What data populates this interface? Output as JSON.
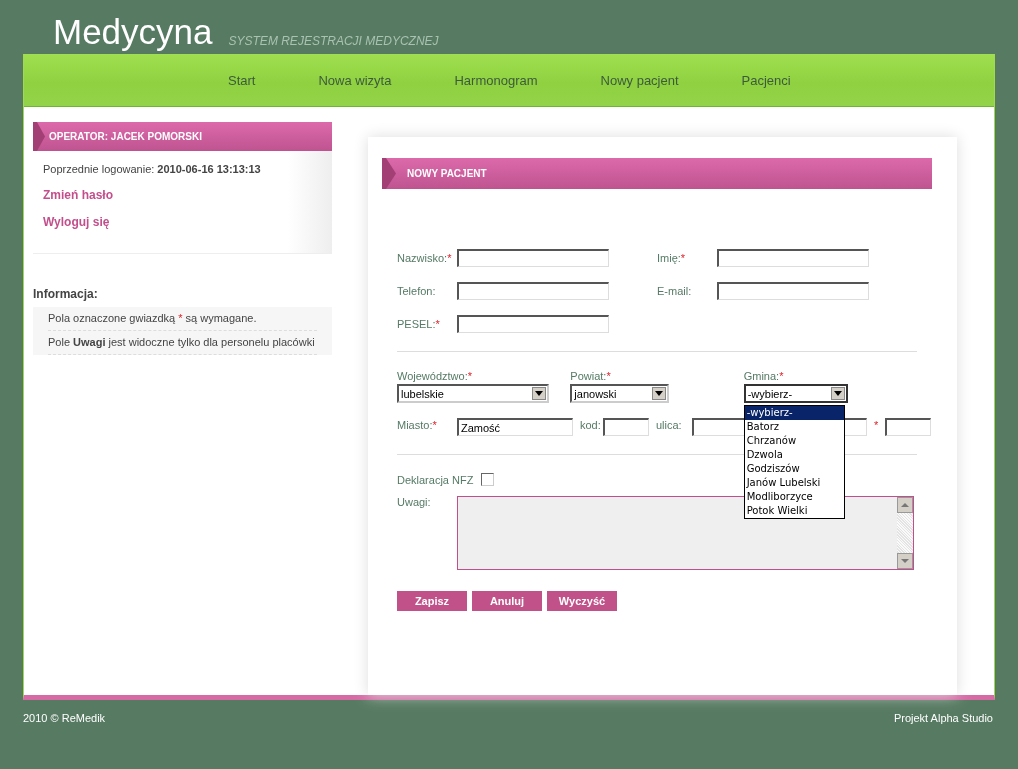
{
  "header": {
    "title": "Medycyna",
    "subtitle": "SYSTEM REJESTRACJI MEDYCZNEJ"
  },
  "nav": [
    {
      "label": "Start"
    },
    {
      "label": "Nowa wizyta"
    },
    {
      "label": "Harmonogram"
    },
    {
      "label": "Nowy pacjent"
    },
    {
      "label": "Pacjenci"
    }
  ],
  "operator_panel": {
    "title": "OPERATOR: JACEK POMORSKI",
    "last_login": "Poprzednie logowanie: **2010-06-16 13:13:13**",
    "links": [
      "Zmień hasło",
      "Wyloguj się"
    ]
  },
  "info": {
    "title": "Informacja:",
    "items": [
      {
        "segments": [
          {
            "text": "Pola oznaczone gwiazdką ",
            "kind": "plain"
          },
          {
            "text": "*",
            "kind": "required"
          },
          {
            "text": " są wymagane.",
            "kind": "plain"
          }
        ]
      },
      {
        "segments": [
          {
            "text": "Pole ",
            "kind": "plain"
          },
          {
            "text": "Uwagi",
            "kind": "bold"
          },
          {
            "text": " jest widoczne tylko dla personelu placówki",
            "kind": "plain"
          }
        ]
      }
    ]
  },
  "form": {
    "title": "NOWY PACJENT",
    "personal_fields": [
      {
        "label": "Nazwisko:",
        "required": true
      },
      {
        "label": "Imię:",
        "required": true
      },
      {
        "label": "Telefon:",
        "required": false
      },
      {
        "label": "E-mail:",
        "required": false
      },
      {
        "label": "PESEL:",
        "required": true
      }
    ],
    "address_selects": [
      {
        "label": "Województwo:",
        "required": true,
        "value": "lubelskie",
        "open": false
      },
      {
        "label": "Powiat:",
        "required": true,
        "value": "janowski",
        "open": false
      },
      {
        "label": "Gmina:",
        "required": true,
        "value": "-wybierz-",
        "open": true,
        "options": [
          {
            "label": "-wybierz-",
            "selected": true
          },
          {
            "label": "Batorz",
            "selected": false
          },
          {
            "label": "Chrzanów",
            "selected": false
          },
          {
            "label": "Dzwola",
            "selected": false
          },
          {
            "label": "Godziszów",
            "selected": false
          },
          {
            "label": "Janów Lubelski",
            "selected": false
          },
          {
            "label": "Modliborzyce",
            "selected": false
          },
          {
            "label": "Potok Wielki",
            "selected": false
          }
        ]
      }
    ],
    "address_fields": [
      {
        "label": "Miasto:",
        "required": true,
        "value": "Zamość"
      },
      {
        "label": "kod:",
        "required": false
      },
      {
        "label": "ulica:",
        "required": false
      },
      {
        "required": true
      }
    ],
    "nfz_declaration": {
      "label": "Deklaracja NFZ",
      "checked": false
    },
    "notes": {
      "label": "Uwagi:"
    },
    "buttons": [
      "Zapisz",
      "Anuluj",
      "Wyczyść"
    ]
  },
  "footer": {
    "left": "2010 © ReMedik",
    "right": "Projekt Alpha Studio"
  }
}
